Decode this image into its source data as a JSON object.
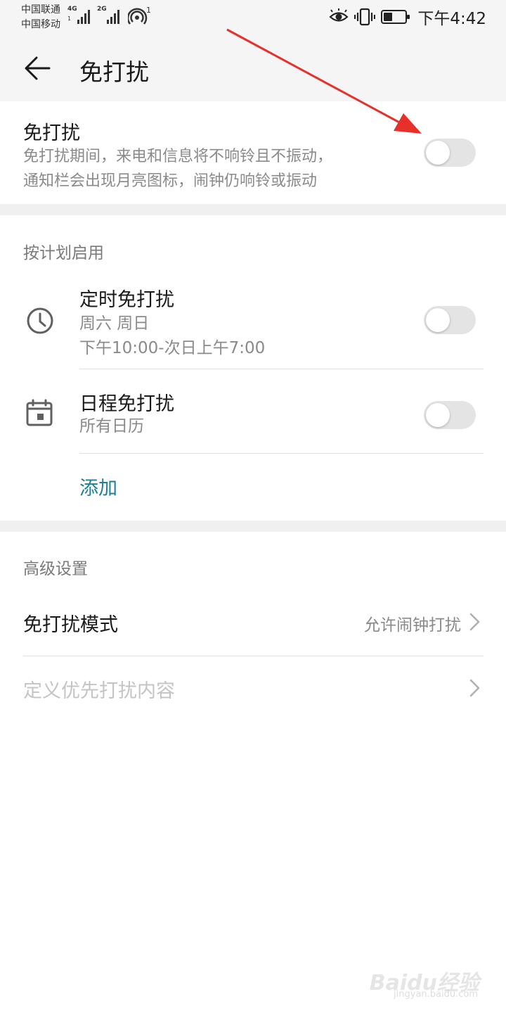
{
  "status_bar": {
    "carrier_1": "中国联通",
    "carrier_2": "中国移动",
    "net_1": "4G",
    "net_1_sub": "1",
    "net_2": "2G",
    "hotspot_count": "1",
    "time": "下午4:42",
    "battery_level": 0.4,
    "icons": [
      "eye-icon",
      "vibrate-icon",
      "battery-icon",
      "signal-icon",
      "hotspot-icon"
    ]
  },
  "header": {
    "back_icon": "arrow-left-icon",
    "title": "免打扰"
  },
  "dnd": {
    "title": "免打扰",
    "description_line1": "免打扰期间，来电和信息将不响铃且不振动，",
    "description_line2": "通知栏会出现月亮图标，闹钟仍响铃或振动",
    "enabled": false
  },
  "schedule": {
    "header": "按计划启用",
    "timed": {
      "title": "定时免打扰",
      "days": "周六 周日",
      "time_range": "下午10:00-次日上午7:00",
      "icon": "clock-icon",
      "enabled": false
    },
    "calendar": {
      "title": "日程免打扰",
      "subtitle": "所有日历",
      "icon": "calendar-icon",
      "enabled": false
    },
    "add_label": "添加"
  },
  "advanced": {
    "header": "高级设置",
    "mode": {
      "title": "免打扰模式",
      "value": "允许闹钟打扰"
    },
    "priority": {
      "title": "定义优先打扰内容"
    }
  },
  "colors": {
    "accent": "#1d7f93",
    "annotation": "#e8302a",
    "switch_off": "#e4e4e4"
  },
  "watermark": {
    "brand": "Baidu经验",
    "url": "jingyan.baidu.com"
  }
}
